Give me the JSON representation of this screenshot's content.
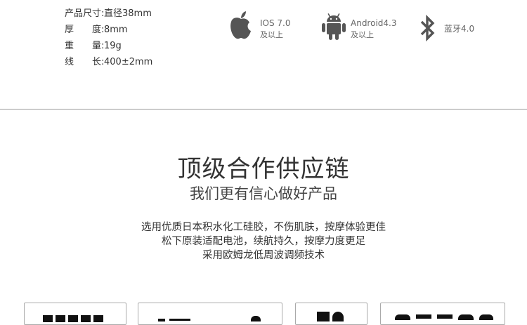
{
  "specs": [
    {
      "label": "产品尺寸",
      "value": "直径38mm"
    },
    {
      "label": "厚度",
      "value": "8mm"
    },
    {
      "label": "重量",
      "value": "19g"
    },
    {
      "label": "线长",
      "value": "400±2mm"
    }
  ],
  "compatibility": [
    {
      "icon": "apple-icon",
      "line1": "IOS 7.0",
      "line2": "及以上"
    },
    {
      "icon": "android-icon",
      "line1": "Android4.3",
      "line2": "及以上"
    },
    {
      "icon": "bluetooth-icon",
      "line1": "蓝牙4.0",
      "line2": ""
    }
  ],
  "heading": {
    "title": "顶级合作供应链",
    "subtitle": "我们更有信心做好产品"
  },
  "description": [
    "选用优质日本积水化工硅胶，不伤肌肤，按摩体验更佳",
    "松下原装适配电池，续航持久，按摩力度更足",
    "采用欧姆龙低周波调频技术"
  ],
  "colors": {
    "divider": "#9a9a9a",
    "text": "#333333",
    "icon": "#555555"
  }
}
